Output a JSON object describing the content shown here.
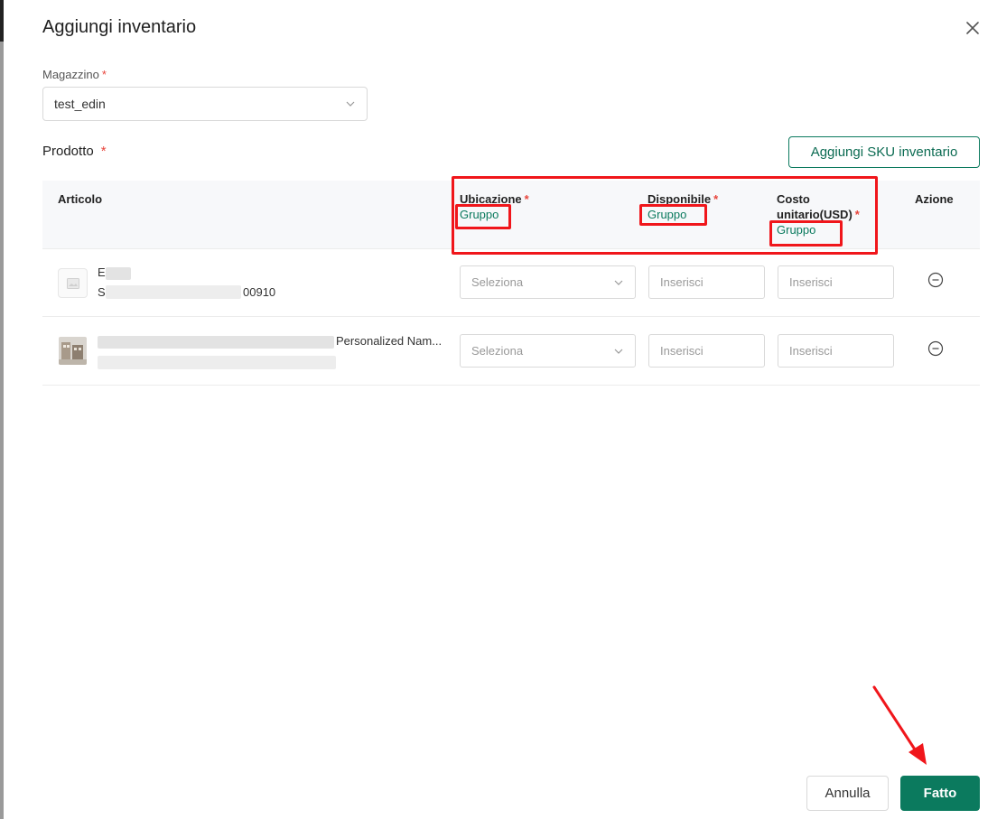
{
  "modal": {
    "title": "Aggiungi inventario"
  },
  "warehouse": {
    "label": "Magazzino",
    "required_mark": "*",
    "value": "test_edin"
  },
  "product": {
    "label": "Prodotto",
    "required_mark": "*",
    "add_sku_button": "Aggiungi SKU inventario"
  },
  "table": {
    "headers": {
      "article": "Articolo",
      "location": "Ubicazione",
      "available": "Disponibile",
      "unit_cost": "Costo unitario(USD)",
      "action": "Azione",
      "required_mark": "*",
      "group_link": "Gruppo"
    },
    "rows": [
      {
        "name_visible": "E",
        "sku_visible": "S",
        "sku_suffix": "00910",
        "location_placeholder": "Seleziona",
        "available_placeholder": "Inserisci",
        "cost_placeholder": "Inserisci"
      },
      {
        "name_visible": "Personalized Nam...",
        "location_placeholder": "Seleziona",
        "available_placeholder": "Inserisci",
        "cost_placeholder": "Inserisci"
      }
    ]
  },
  "footer": {
    "cancel": "Annulla",
    "done": "Fatto"
  },
  "colors": {
    "primary": "#0b7a5e",
    "required": "#e8453c",
    "annotation": "#f0161b"
  },
  "icons": {
    "close": "close-icon",
    "chevron": "chevron-down-icon",
    "image_placeholder": "image-placeholder-icon",
    "remove": "minus-circle-icon"
  }
}
